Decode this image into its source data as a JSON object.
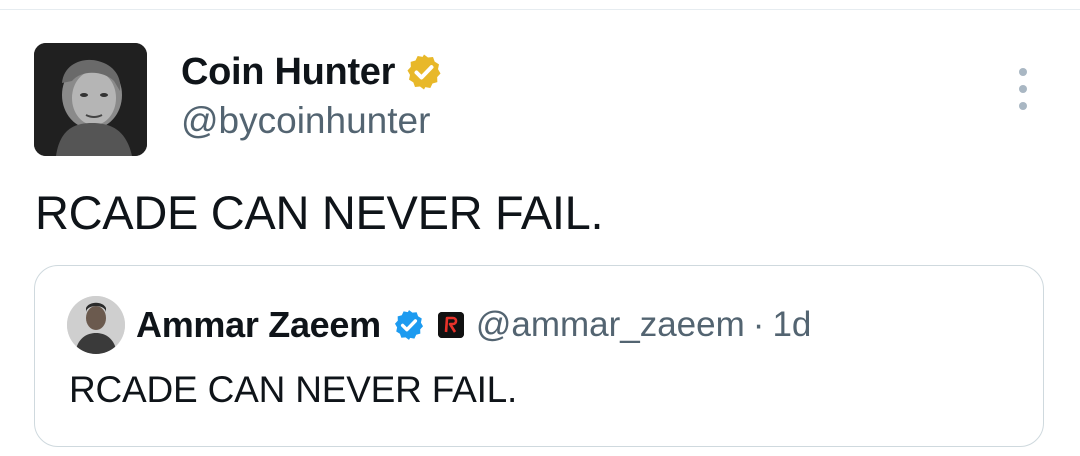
{
  "tweet": {
    "author": {
      "display_name": "Coin Hunter",
      "handle": "@bycoinhunter",
      "verified_badge": "gold-verified-icon",
      "badge_color": "#e8b829"
    },
    "text": "RCADE CAN NEVER FAIL.",
    "menu_icon": "more-vertical-icon"
  },
  "quote": {
    "author": {
      "display_name": "Ammar Zaeem",
      "handle": "@ammar_zaeem",
      "verified_badge": "blue-verified-icon",
      "badge_color": "#1d9bf0",
      "affiliate_icon": "rcade-affiliate-icon"
    },
    "separator": "·",
    "timestamp": "1d",
    "text": "RCADE CAN NEVER FAIL."
  },
  "colors": {
    "text_primary": "#0f1419",
    "text_secondary": "#536471",
    "border": "#cfd9de"
  }
}
